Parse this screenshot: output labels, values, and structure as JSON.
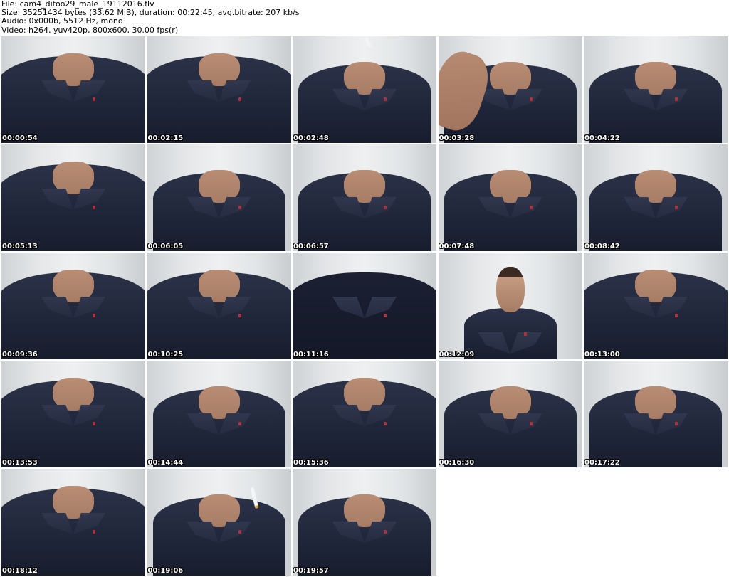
{
  "header": {
    "file": "File: cam4_ditoo29_male_19112016.flv",
    "size": "Size: 35251434 bytes (33.62 MiB), duration: 00:22:45, avg.bitrate: 207 kb/s",
    "audio": "Audio: 0x000b, 5512 Hz, mono",
    "video": "Video: h264, yuv420p, 800x600, 30.00 fps(r)"
  },
  "thumbnails": [
    {
      "time": "00:00:54"
    },
    {
      "time": "00:02:15"
    },
    {
      "time": "00:02:48"
    },
    {
      "time": "00:03:28"
    },
    {
      "time": "00:04:22"
    },
    {
      "time": "00:05:13"
    },
    {
      "time": "00:06:05"
    },
    {
      "time": "00:06:57"
    },
    {
      "time": "00:07:48"
    },
    {
      "time": "00:08:42"
    },
    {
      "time": "00:09:36"
    },
    {
      "time": "00:10:25"
    },
    {
      "time": "00:11:16"
    },
    {
      "time": "00:12:09"
    },
    {
      "time": "00:13:00"
    },
    {
      "time": "00:13:53"
    },
    {
      "time": "00:14:44"
    },
    {
      "time": "00:15:36"
    },
    {
      "time": "00:16:30"
    },
    {
      "time": "00:17:22"
    },
    {
      "time": "00:18:12"
    },
    {
      "time": "00:19:06"
    },
    {
      "time": "00:19:57"
    }
  ]
}
